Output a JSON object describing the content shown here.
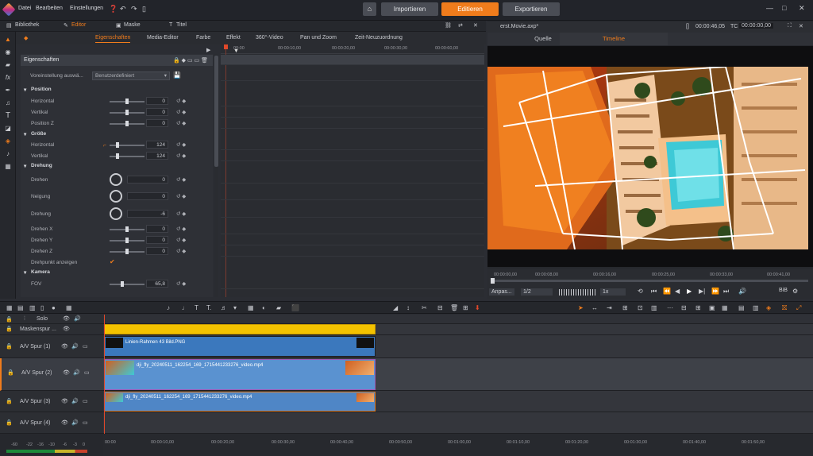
{
  "menu": {
    "file": "Datei",
    "edit": "Bearbeiten",
    "settings": "Einstellungen"
  },
  "mode_tabs": {
    "import": "Importieren",
    "edit": "Editieren",
    "export": "Exportieren"
  },
  "left_tabs": {
    "library": "Bibliothek",
    "editor": "Editor",
    "mask": "Maske",
    "title": "Titel"
  },
  "sub_tabs": [
    "Eigenschaften",
    "Media-Editor",
    "Farbe",
    "Effekt",
    "360°-Video",
    "Pan und Zoom",
    "Zeit-Neuzuordnung"
  ],
  "props": {
    "header": "Eigenschaften",
    "preset_label": "Voreinstellung auswä...",
    "preset_value": "Benutzerdefiniert",
    "position": "Position",
    "horizontal": "Horizontal",
    "vertical": "Vertikal",
    "positionz": "Position Z",
    "pos_h": "0",
    "pos_v": "0",
    "pos_z": "0",
    "size": "Größe",
    "size_h": "124",
    "size_v": "124",
    "rotation": "Drehung",
    "rotate": "Drehen",
    "tilt": "Neigung",
    "spin": "Drehung",
    "rot_val": "0",
    "tilt_val": "0",
    "spin_val": "-6",
    "rx": "Drehen X",
    "ry": "Drehen Y",
    "rz": "Drehen Z",
    "rx_val": "0",
    "ry_val": "0",
    "rz_val": "0",
    "pivot": "Drehpunkt anzeigen",
    "camera": "Kamera",
    "fov": "FOV",
    "fov_val": "65,8"
  },
  "mini_ruler": [
    "00:00",
    "00:00:10,00",
    "00:00:20,00",
    "00:00:30,00",
    "00:00:40,00",
    "00:00:50,00",
    "00:00:60,00"
  ],
  "preview": {
    "filename": "erst.Movie.axp*",
    "timecode1": "00:00:46,05",
    "tc_label": "TC",
    "timecode2": "00:00:00,00",
    "tab_source": "Quelle",
    "tab_timeline": "Timeline",
    "ruler": [
      "00:00:00,00",
      "00:00:08,00",
      "00:00:16,00",
      "00:00:25,00",
      "00:00:33,00",
      "00:00:41,00"
    ],
    "fit": "Anpas...",
    "ratio": "1/2",
    "speed": "1x",
    "pip": "BiB"
  },
  "tracks": {
    "solo": "Solo",
    "mask": "Maskenspur ...",
    "av1": "A/V Spur (1)",
    "av2": "A/V Spur (2)",
    "av3": "A/V Spur (3)",
    "av4": "A/V Spur (4)",
    "clip1": "Linien-Rahmen 43 Bild.PNG",
    "clip2": "dji_fly_20240511_162254_169_1715441233276_video.mp4",
    "clip3": "dji_fly_20240511_162254_169_1715441233276_video.mp4"
  },
  "bottom_ruler": [
    "00:00",
    "00:00:10,00",
    "00:00:20,00",
    "00:00:30,00",
    "00:00:40,00",
    "00:00:50,00",
    "00:01:00,00",
    "00:01:10,00",
    "00:01:20,00",
    "00:01:30,00",
    "00:01:40,00",
    "00:01:50,00"
  ],
  "meter": [
    "-60",
    "-22",
    "-16",
    "-10",
    "-6",
    "-3",
    "0"
  ],
  "colors": {
    "accent": "#f07c1c",
    "clip_blue": "#4f86c6",
    "mask_yellow": "#f3c200",
    "selection": "#9b59b6"
  }
}
